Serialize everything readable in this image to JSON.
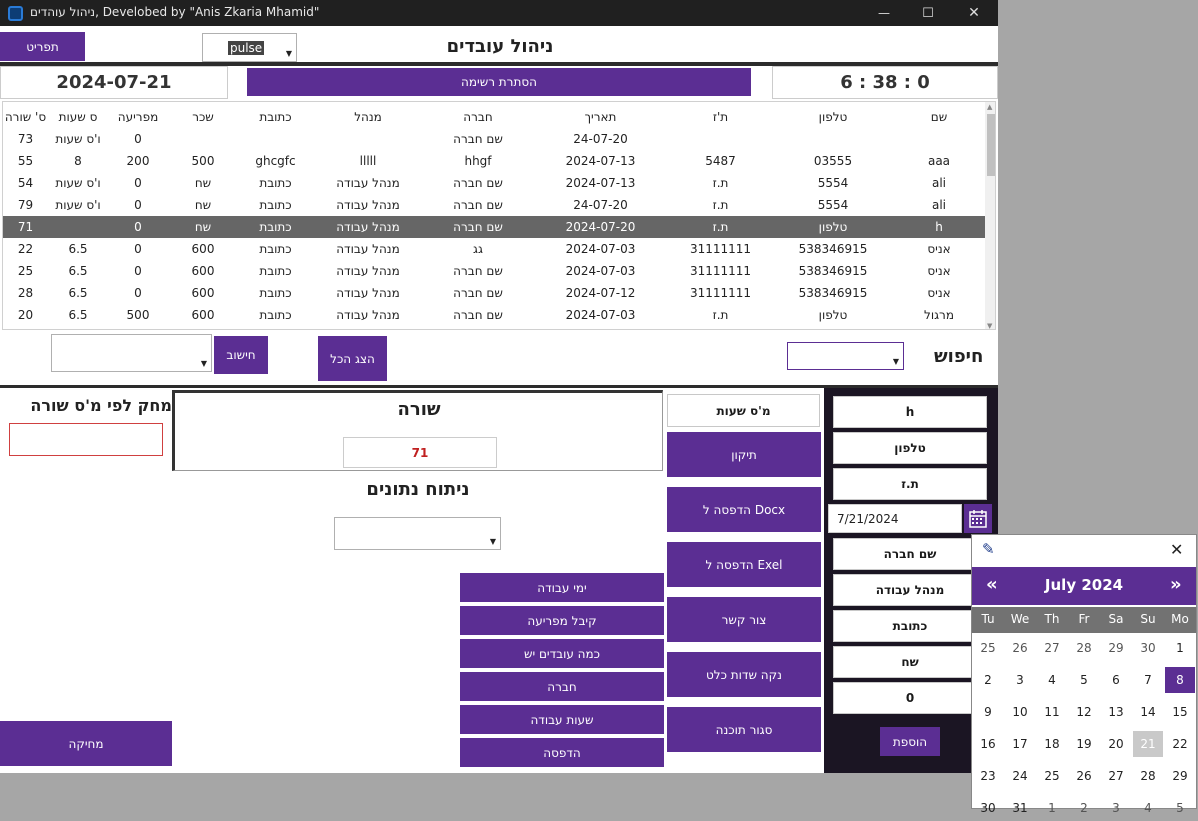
{
  "window": {
    "title": "ניהול עוהדים, Develobed by \"Anis Zkaria Mhamid\"",
    "controls": [
      "—",
      "☐",
      "✕"
    ]
  },
  "header": {
    "menu_label": "תפריט",
    "theme_combo_value": "pulse",
    "page_title": "ניהול עובדים",
    "date": "2024-07-21",
    "hide_list_label": "הסתרת רשימה",
    "clock": "6 : 38 : 0"
  },
  "table": {
    "columns": [
      "שם",
      "טלפון",
      "ת'ז",
      "תאריך",
      "חברה",
      "מנהל",
      "כתובת",
      "שכר",
      "מפריעה",
      "ס שעות",
      "ס' שורה"
    ],
    "rows": [
      [
        "",
        "",
        "",
        "24-07-20",
        "שם חברה",
        "",
        "",
        "",
        "0",
        "ו'ס שעות",
        "73"
      ],
      [
        "aaa",
        "03555",
        "5487",
        "2024-07-13",
        "hhgf",
        "lllll",
        "ghcgfc",
        "500",
        "200",
        "8",
        "55"
      ],
      [
        "ali",
        "5554",
        "ת.ז",
        "2024-07-13",
        "שם חברה",
        "מנהל עבודה",
        "כתובת",
        "שח",
        "0",
        "ו'ס שעות",
        "54"
      ],
      [
        "ali",
        "5554",
        "ת.ז",
        "24-07-20",
        "שם חברה",
        "מנהל עבודה",
        "כתובת",
        "שח",
        "0",
        "ו'ס שעות",
        "79"
      ],
      [
        "h",
        "טלפון",
        "ת.ז",
        "2024-07-20",
        "שם חברה",
        "מנהל עבודה",
        "כתובת",
        "שח",
        "0",
        "",
        "71"
      ],
      [
        "אניס",
        "538346915",
        "31111111",
        "2024-07-03",
        "גג",
        "מנהל עבודה",
        "כתובת",
        "600",
        "0",
        "6.5",
        "22"
      ],
      [
        "אניס",
        "538346915",
        "31111111",
        "2024-07-03",
        "שם חברה",
        "מנהל עבודה",
        "כתובת",
        "600",
        "0",
        "6.5",
        "25"
      ],
      [
        "אניס",
        "538346915",
        "31111111",
        "2024-07-12",
        "שם חברה",
        "מנהל עבודה",
        "כתובת",
        "600",
        "0",
        "6.5",
        "28"
      ],
      [
        "מרגול",
        "טלפון",
        "ת.ז",
        "2024-07-03",
        "שם חברה",
        "מנהל עבודה",
        "כתובת",
        "600",
        "500",
        "6.5",
        "20"
      ]
    ],
    "selected_row": 4
  },
  "search": {
    "label": "חיפוש",
    "show_all_label": "הצג הכל",
    "calc_label": "חישוב"
  },
  "delete_panel": {
    "title": "מחק לפי מ'ס שורה",
    "delete_label": "מחיקה"
  },
  "row_panel": {
    "title": "שורה",
    "row_value": "71",
    "analysis_title": "ניתוח נתונים"
  },
  "analysis_buttons": [
    "ימי עבודה",
    "קיבל מפריעה",
    "כמה עובדים יש",
    "חברה",
    "שעות עבודה",
    "הדפסה"
  ],
  "action_buttons": {
    "hours_field": "מ'ס שעות",
    "fix": "תיקון",
    "print_docx": "הדפסה ל Docx",
    "print_excel": "הדפסה ל Exel",
    "contact": "צור קשר",
    "clear_all": "נקה שדות כלט",
    "close_app": "סגור תוכנה"
  },
  "form": {
    "name": "h",
    "phone": "טלפון",
    "id": "ת.ז",
    "date": "7/21/2024",
    "company": "שם חברה",
    "manager": "מנהל עבודה",
    "address": "כתובת",
    "salary": "שח",
    "advance": "0",
    "add_label": "הוספת"
  },
  "calendar": {
    "month_title": "July 2024",
    "prev": "«",
    "next": "»",
    "weekdays": [
      "Tu",
      "We",
      "Th",
      "Fr",
      "Sa",
      "Su",
      "Mo"
    ],
    "weeks": [
      [
        "25",
        "26",
        "27",
        "28",
        "29",
        "30",
        "1"
      ],
      [
        "2",
        "3",
        "4",
        "5",
        "6",
        "7",
        "8"
      ],
      [
        "9",
        "10",
        "11",
        "12",
        "13",
        "14",
        "15"
      ],
      [
        "16",
        "17",
        "18",
        "19",
        "20",
        "21",
        "22"
      ],
      [
        "23",
        "24",
        "25",
        "26",
        "27",
        "28",
        "29"
      ],
      [
        "30",
        "31",
        "1",
        "2",
        "3",
        "4",
        "5"
      ]
    ],
    "selected_day": "8",
    "today_day": "21",
    "accent_color": "#5b2e93"
  }
}
